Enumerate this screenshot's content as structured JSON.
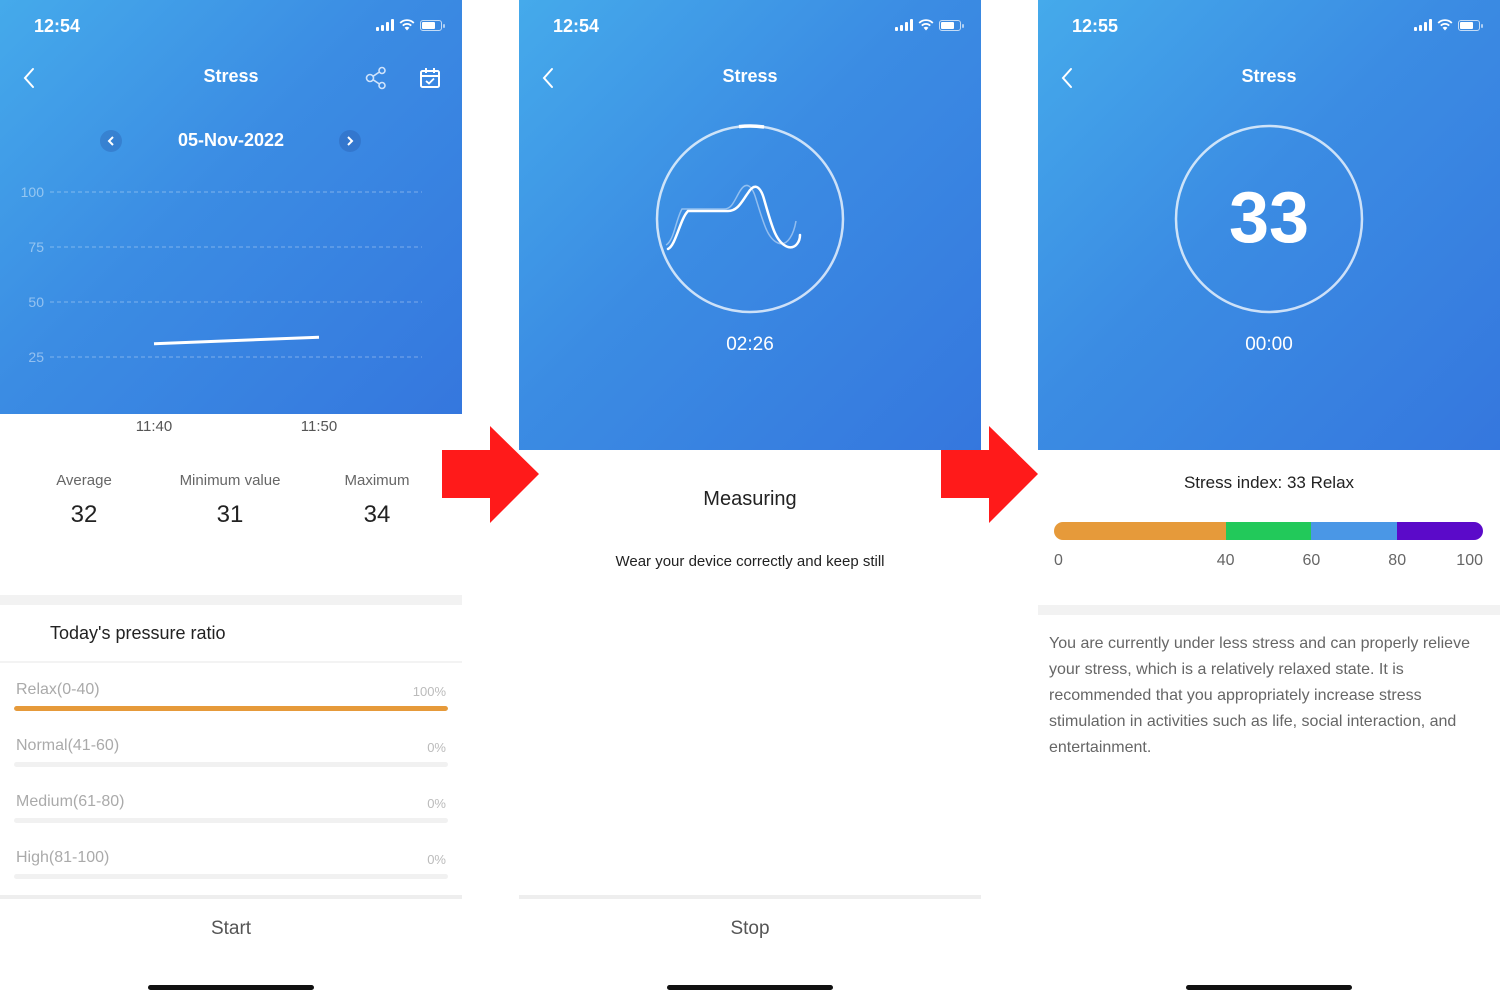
{
  "colors": {
    "hero_gradient_start": "#45aaeb",
    "hero_gradient_end": "#3577de",
    "relax": "#e69a3a",
    "normal": "#22c95a",
    "medium": "#4a97e6",
    "high": "#5b0ac9",
    "arrow": "#ff1a1a"
  },
  "screens": [
    {
      "status_time": "12:54",
      "title": "Stress",
      "date": "05-Nov-2022",
      "stats": [
        {
          "label": "Average",
          "value": "32"
        },
        {
          "label": "Minimum value",
          "value": "31"
        },
        {
          "label": "Maximum",
          "value": "34"
        }
      ],
      "ratio_title": "Today's pressure ratio",
      "ratios": [
        {
          "label": "Relax(0-40)",
          "percent_text": "100%",
          "percent": 100
        },
        {
          "label": "Normal(41-60)",
          "percent_text": "0%",
          "percent": 0
        },
        {
          "label": "Medium(61-80)",
          "percent_text": "0%",
          "percent": 0
        },
        {
          "label": "High(81-100)",
          "percent_text": "0%",
          "percent": 0
        }
      ],
      "button": "Start"
    },
    {
      "status_time": "12:54",
      "title": "Stress",
      "timer": "02:26",
      "status": "Measuring",
      "hint": "Wear your device correctly and keep still",
      "button": "Stop"
    },
    {
      "status_time": "12:55",
      "title": "Stress",
      "value": "33",
      "timer": "00:00",
      "index_text": "Stress index: 33 Relax",
      "scale_segments": [
        {
          "from": 0,
          "to": 40,
          "color_key": "relax"
        },
        {
          "from": 40,
          "to": 60,
          "color_key": "normal"
        },
        {
          "from": 60,
          "to": 80,
          "color_key": "medium"
        },
        {
          "from": 80,
          "to": 100,
          "color_key": "high"
        }
      ],
      "scale_ticks": [
        "0",
        "40",
        "60",
        "80",
        "100"
      ],
      "advice": "You are currently under less stress and can properly relieve your stress, which is a relatively relaxed state. It is recommended that you appropriately increase stress stimulation in activities such as life, social interaction, and entertainment."
    }
  ],
  "chart_data": {
    "type": "line",
    "title": "",
    "xlabel": "",
    "ylabel": "",
    "x": [
      "11:40",
      "11:50"
    ],
    "series": [
      {
        "name": "Stress",
        "values": [
          31,
          34
        ]
      }
    ],
    "ylim": [
      0,
      100
    ],
    "yticks": [
      25,
      50,
      75,
      100
    ],
    "xticks": [
      "11:40",
      "11:50"
    ],
    "grid": true,
    "legend": "none"
  }
}
